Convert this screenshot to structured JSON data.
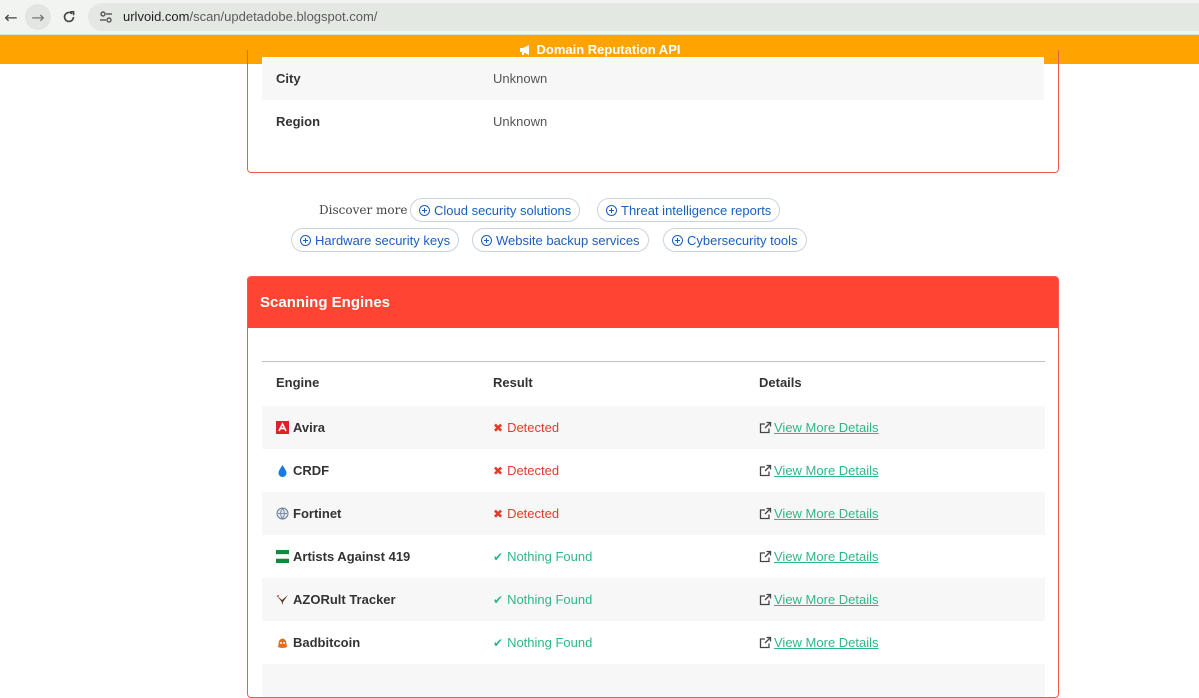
{
  "browser": {
    "url_host": "urlvoid.com",
    "url_path": "/scan/updetadobe.blogspot.com/"
  },
  "banner": {
    "label": "Domain Reputation API"
  },
  "info": {
    "rows": [
      {
        "key": "City",
        "value": "Unknown"
      },
      {
        "key": "Region",
        "value": "Unknown"
      }
    ]
  },
  "discover": {
    "label": "Discover more",
    "chips": [
      "Cloud security solutions",
      "Threat intelligence reports",
      "Hardware security keys",
      "Website backup services",
      "Cybersecurity tools"
    ]
  },
  "scan": {
    "title": "Scanning Engines",
    "headers": {
      "engine": "Engine",
      "result": "Result",
      "details": "Details"
    },
    "rows": [
      {
        "engine": "Avira",
        "result": "Detected",
        "status": "detected",
        "icon": "avira-logo-icon",
        "details": "View More Details"
      },
      {
        "engine": "CRDF",
        "result": "Detected",
        "status": "detected",
        "icon": "crdf-logo-icon",
        "details": "View More Details"
      },
      {
        "engine": "Fortinet",
        "result": "Detected",
        "status": "detected",
        "icon": "fortinet-logo-icon",
        "details": "View More Details"
      },
      {
        "engine": "Artists Against 419",
        "result": "Nothing Found",
        "status": "clean",
        "icon": "artists-against-419-logo-icon",
        "details": "View More Details"
      },
      {
        "engine": "AZORult Tracker",
        "result": "Nothing Found",
        "status": "clean",
        "icon": "azorult-tracker-logo-icon",
        "details": "View More Details"
      },
      {
        "engine": "Badbitcoin",
        "result": "Nothing Found",
        "status": "clean",
        "icon": "badbitcoin-logo-icon",
        "details": "View More Details"
      }
    ]
  },
  "colors": {
    "banner": "#ffa301",
    "scan_header": "#fe4533",
    "detected": "#e33b2b",
    "clean": "#2fb786",
    "chip_text": "#1a5fc0"
  }
}
